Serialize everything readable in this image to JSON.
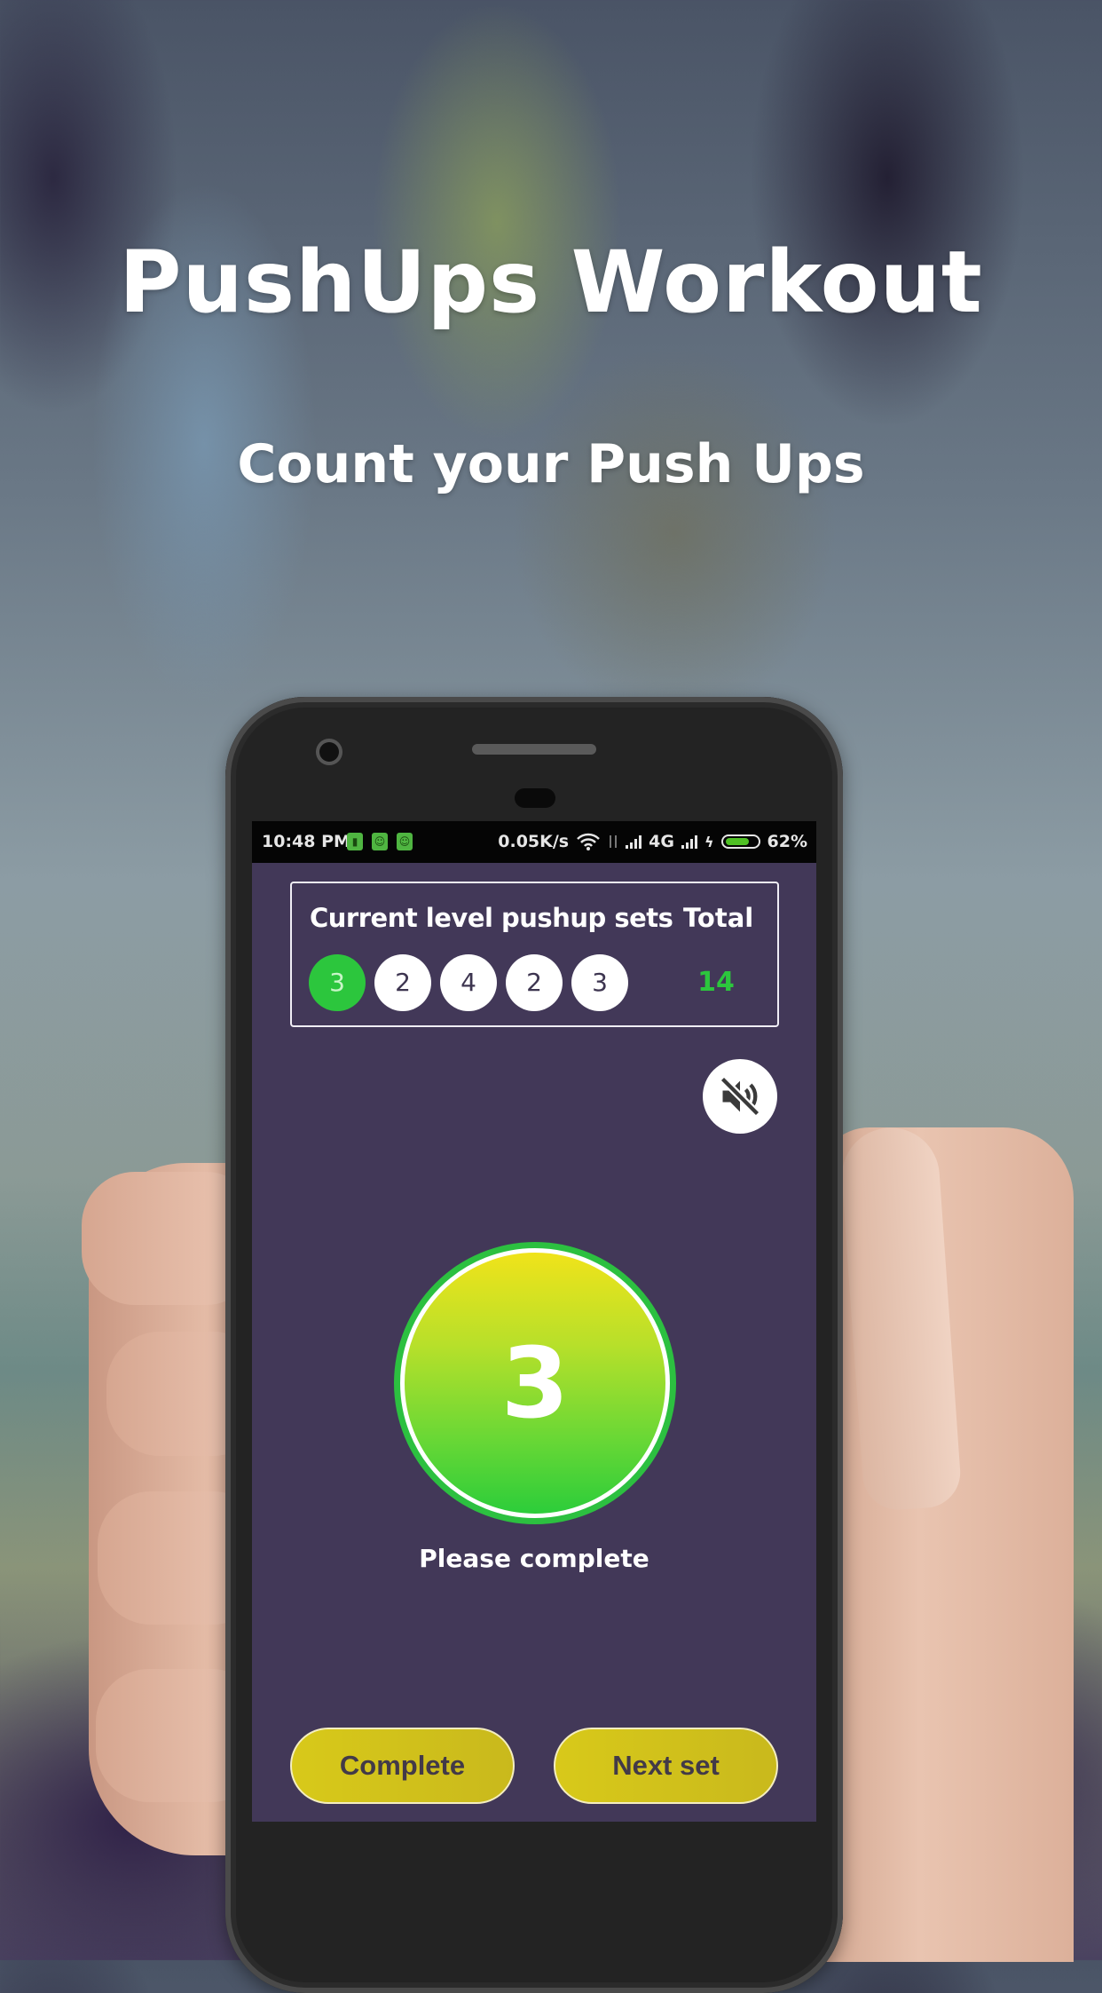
{
  "promo": {
    "title": "PushUps Workout",
    "subtitle": "Count your Push Ups"
  },
  "status_bar": {
    "time": "10:48 PM",
    "notification_icons": [
      "battery-saver-icon",
      "app-notification-icon",
      "app-notification-icon"
    ],
    "network_speed": "0.05K/s",
    "network_type": "4G",
    "battery_percent": "62%",
    "battery_level": 0.62,
    "charging": true
  },
  "sets_panel": {
    "label": "Current level pushup sets",
    "total_label": "Total",
    "sets": [
      {
        "value": "3",
        "active": true
      },
      {
        "value": "2",
        "active": false
      },
      {
        "value": "4",
        "active": false
      },
      {
        "value": "2",
        "active": false
      },
      {
        "value": "3",
        "active": false
      }
    ],
    "total_value": "14"
  },
  "sound": {
    "icon": "volume-mute-icon",
    "muted": true
  },
  "counter": {
    "value": "3",
    "prompt": "Please complete"
  },
  "actions": {
    "complete_label": "Complete",
    "next_set_label": "Next set"
  },
  "colors": {
    "screen_bg": "#423858",
    "accent_green": "#2cc63d",
    "button_yellow": "#d8c91a",
    "counter_gradient_top": "#f0e31a",
    "counter_gradient_bottom": "#2ccd3a"
  }
}
